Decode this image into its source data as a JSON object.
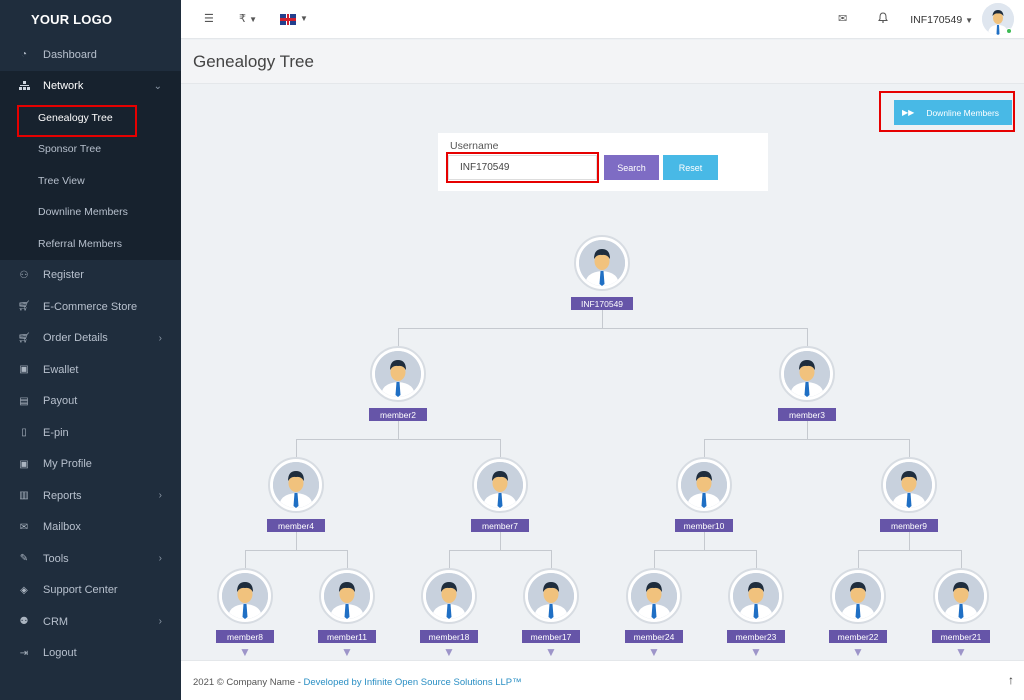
{
  "sidebar": {
    "logo": "YOUR LOGO",
    "items": [
      {
        "label": "Dashboard",
        "icon": "dashboard-icon"
      },
      {
        "label": "Network",
        "icon": "sitemap-icon"
      },
      {
        "label": "Register",
        "icon": "user-plus-icon"
      },
      {
        "label": "E-Commerce Store",
        "icon": "cart-icon"
      },
      {
        "label": "Order Details",
        "icon": "cart-icon"
      },
      {
        "label": "Ewallet",
        "icon": "briefcase-icon"
      },
      {
        "label": "Payout",
        "icon": "money-icon"
      },
      {
        "label": "E-pin",
        "icon": "bookmark-icon"
      },
      {
        "label": "My Profile",
        "icon": "profile-icon"
      },
      {
        "label": "Reports",
        "icon": "bar-chart-icon"
      },
      {
        "label": "Mailbox",
        "icon": "mail-icon"
      },
      {
        "label": "Tools",
        "icon": "wrench-icon"
      },
      {
        "label": "Support Center",
        "icon": "ticket-icon"
      },
      {
        "label": "CRM",
        "icon": "users-icon"
      },
      {
        "label": "Logout",
        "icon": "logout-icon"
      }
    ],
    "network_submenu": [
      {
        "label": "Genealogy Tree",
        "active": true
      },
      {
        "label": "Sponsor Tree"
      },
      {
        "label": "Tree View"
      },
      {
        "label": "Downline Members"
      },
      {
        "label": "Referral Members"
      }
    ]
  },
  "topbar": {
    "currency": "₹",
    "language_flag": "uk-flag-icon",
    "username": "INF170549"
  },
  "page": {
    "title": "Genealogy Tree",
    "downline_button": "Downline Members"
  },
  "search": {
    "label": "Username",
    "value": "INF170549",
    "search_button": "Search",
    "reset_button": "Reset"
  },
  "tree": {
    "root": "INF170549",
    "level1": [
      "member2",
      "member3"
    ],
    "level2": [
      "member4",
      "member7",
      "member10",
      "member9"
    ],
    "level3": [
      "member8",
      "member11",
      "member18",
      "member17",
      "member24",
      "member23",
      "member22",
      "member21"
    ]
  },
  "footer": {
    "text": "2021 © Company Name - ",
    "link": "Developed by Infinite Open Source Solutions LLP™"
  },
  "colors": {
    "sidebar_bg": "#1f2d3d",
    "accent_purple": "#6655a8",
    "accent_blue": "#48b9e6",
    "highlight_red": "#e60000"
  }
}
